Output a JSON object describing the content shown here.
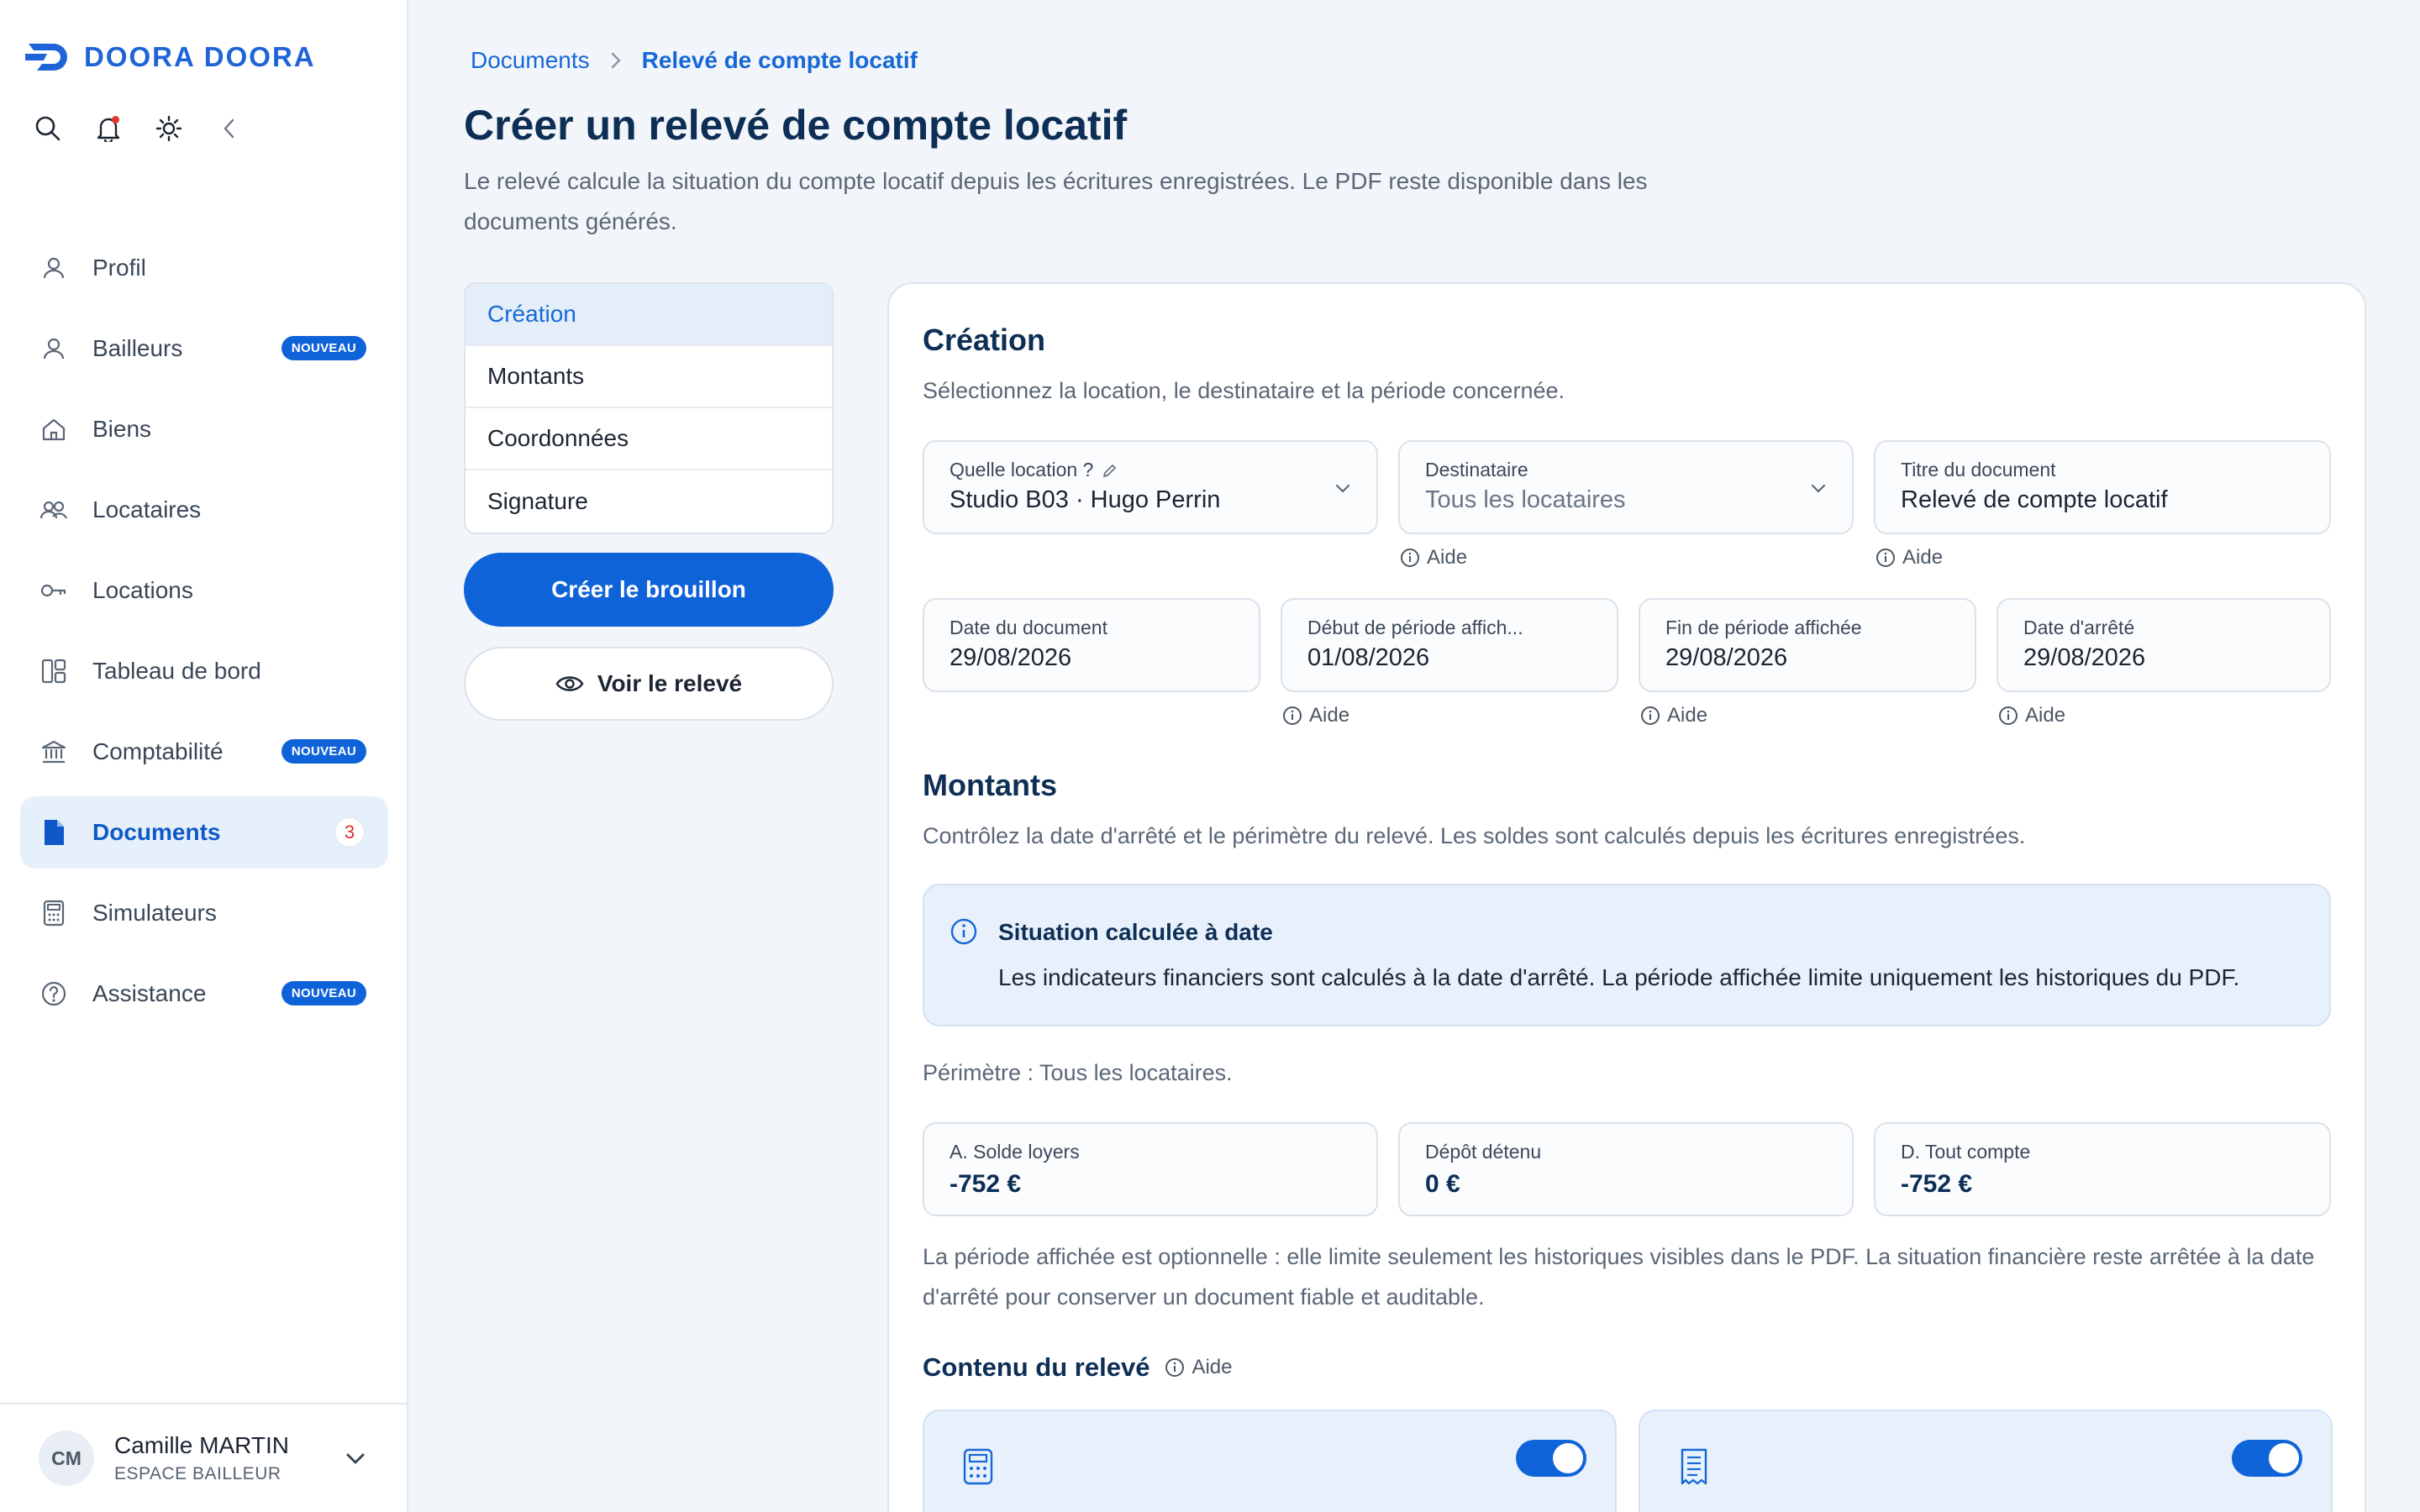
{
  "brand": {
    "name": "DOORA DOORA",
    "color": "#1f64d6"
  },
  "sidebar": {
    "tools": [
      "search-icon",
      "bell-icon",
      "sun-icon",
      "collapse-icon"
    ],
    "items": [
      {
        "label": "Profil",
        "icon": "user-icon"
      },
      {
        "label": "Bailleurs",
        "icon": "user-icon",
        "badge": "NOUVEAU"
      },
      {
        "label": "Biens",
        "icon": "home-icon"
      },
      {
        "label": "Locataires",
        "icon": "users-icon"
      },
      {
        "label": "Locations",
        "icon": "key-icon"
      },
      {
        "label": "Tableau de bord",
        "icon": "dashboard-icon"
      },
      {
        "label": "Comptabilité",
        "icon": "bank-icon",
        "badge": "NOUVEAU"
      },
      {
        "label": "Documents",
        "icon": "document-icon",
        "count": "3",
        "active": true
      },
      {
        "label": "Simulateurs",
        "icon": "calculator-icon"
      },
      {
        "label": "Assistance",
        "icon": "help-icon",
        "badge": "NOUVEAU"
      }
    ],
    "user": {
      "initials": "CM",
      "name": "Camille MARTIN",
      "role": "ESPACE BAILLEUR"
    }
  },
  "breadcrumb": {
    "parent": "Documents",
    "current": "Relevé de compte locatif"
  },
  "page": {
    "title": "Créer un relevé de compte locatif",
    "description": "Le relevé calcule la situation du compte locatif depuis les écritures enregistrées. Le PDF reste disponible dans les documents générés."
  },
  "steps": [
    "Création",
    "Montants",
    "Coordonnées",
    "Signature"
  ],
  "actions": {
    "create": "Créer le brouillon",
    "preview": "Voir le relevé"
  },
  "creation": {
    "title": "Création",
    "description": "Sélectionnez la location, le destinataire et la période concernée.",
    "location": {
      "label": "Quelle location ?",
      "value": "Studio B03 · Hugo Perrin"
    },
    "recipient": {
      "label": "Destinataire",
      "value": "Tous les locataires"
    },
    "doc_title": {
      "label": "Titre du document",
      "value": "Relevé de compte locatif"
    },
    "doc_date": {
      "label": "Date du document",
      "value": "29/08/2026"
    },
    "period_start": {
      "label": "Début de période affich...",
      "value": "01/08/2026"
    },
    "period_end": {
      "label": "Fin de période affichée",
      "value": "29/08/2026"
    },
    "stop_date": {
      "label": "Date d'arrêté",
      "value": "29/08/2026"
    },
    "help_label": "Aide"
  },
  "amounts": {
    "title": "Montants",
    "description": "Contrôlez la date d'arrêté et le périmètre du relevé. Les soldes sont calculés depuis les écritures enregistrées.",
    "info_title": "Situation calculée à date",
    "info_text": "Les indicateurs financiers sont calculés à la date d'arrêté. La période affichée limite uniquement les historiques du PDF.",
    "perimeter": "Périmètre : Tous les locataires.",
    "kpis": [
      {
        "label": "A. Solde loyers",
        "value": "-752 €"
      },
      {
        "label": "Dépôt détenu",
        "value": "0 €"
      },
      {
        "label": "D. Tout compte",
        "value": "-752 €"
      }
    ],
    "note": "La période affichée est optionnelle : elle limite seulement les historiques visibles dans le PDF. La situation financière reste arrêtée à la date d'arrêté pour conserver un document fiable et auditable."
  },
  "content": {
    "title": "Contenu du relevé",
    "help_label": "Aide",
    "options": [
      {
        "icon": "calculator-icon",
        "enabled": true
      },
      {
        "icon": "receipt-icon",
        "enabled": true
      }
    ]
  }
}
